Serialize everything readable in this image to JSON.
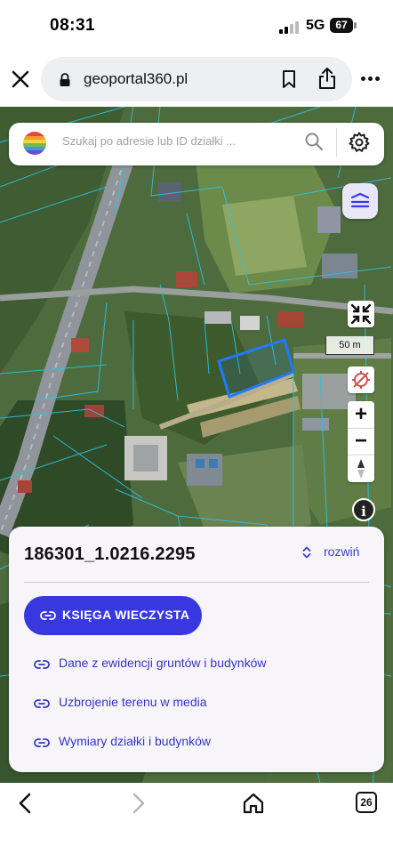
{
  "status_bar": {
    "time": "08:31",
    "network": "5G",
    "battery": "67"
  },
  "browser": {
    "url": "geoportal360.pl",
    "icons": [
      "close-icon",
      "lock-icon",
      "bookmark-icon",
      "share-icon",
      "more-icon"
    ]
  },
  "map": {
    "search_placeholder": "Szukaj po adresie lub ID działki ...",
    "scale_label": "50 m",
    "info_label": "i",
    "zoom_in": "+",
    "zoom_out": "−",
    "colors": {
      "parcel_lines": "#22b8d8",
      "selected_parcel": "#1e7bff",
      "accent": "#3838e0"
    }
  },
  "panel": {
    "parcel_id": "186301_1.0216.2295",
    "expand_label": "rozwiń",
    "primary_button": "KSIĘGA WIECZYSTA",
    "links": [
      {
        "label": "Dane z ewidencji gruntów i budynków"
      },
      {
        "label": "Uzbrojenie terenu w media"
      },
      {
        "label": "Wymiary działki i budynków"
      }
    ]
  },
  "bottom_nav": {
    "tab_count": "26"
  }
}
